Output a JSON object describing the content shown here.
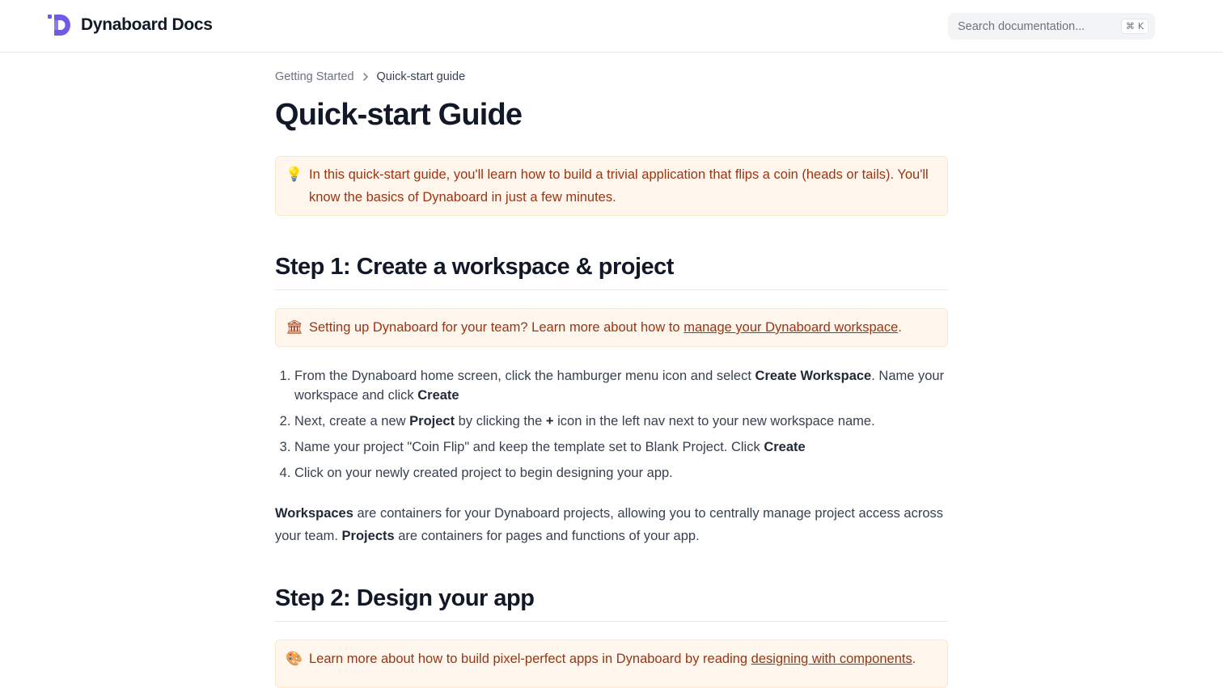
{
  "header": {
    "brand_name": "Dynaboard Docs",
    "search_placeholder": "Search documentation...",
    "search_shortcut_mod": "⌘",
    "search_shortcut_key": "K"
  },
  "breadcrumb": {
    "parent": "Getting Started",
    "current": "Quick-start guide"
  },
  "page_title": "Quick-start Guide",
  "intro_callout": {
    "icon": "lightbulb-icon",
    "text": "In this quick-start guide, you'll learn how to build a trivial application that flips a coin (heads or tails). You'll know the basics of Dynaboard in just a few minutes."
  },
  "step1": {
    "heading": "Step 1: Create a workspace & project",
    "callout": {
      "icon": "bank-icon",
      "text_before": "Setting up Dynaboard for your team? Learn more about how to ",
      "link_text": "manage your Dynaboard workspace",
      "text_after": "."
    },
    "list": [
      {
        "parts": [
          "From the Dynaboard home screen, click the hamburger menu icon and select ",
          "Create Workspace",
          ". Name your workspace and click ",
          "Create",
          ""
        ]
      },
      {
        "parts": [
          "Next, create a new ",
          "Project",
          " by clicking the ",
          "+",
          " icon in the left nav next to your new workspace name."
        ]
      },
      {
        "parts": [
          "Name your project \"Coin Flip\" and keep the template set to Blank Project. Click ",
          "Create",
          ""
        ]
      },
      {
        "parts": [
          "Click on your newly created project to begin designing your app."
        ]
      }
    ],
    "paragraph": {
      "parts": [
        "Workspaces",
        " are containers for your Dynaboard projects, allowing you to centrally manage project access across your team. ",
        "Projects",
        " are containers for pages and functions of your app."
      ]
    }
  },
  "step2": {
    "heading": "Step 2: Design your app",
    "callout": {
      "icon": "palette-icon",
      "text_before": "Learn more about how to build pixel-perfect apps in Dynaboard by reading ",
      "link_text": "designing with components",
      "text_after": "."
    }
  },
  "colors": {
    "accent": "#6d5ce8",
    "callout_bg": "#fff7ed",
    "callout_text": "#9a3412",
    "heading": "#111827"
  }
}
